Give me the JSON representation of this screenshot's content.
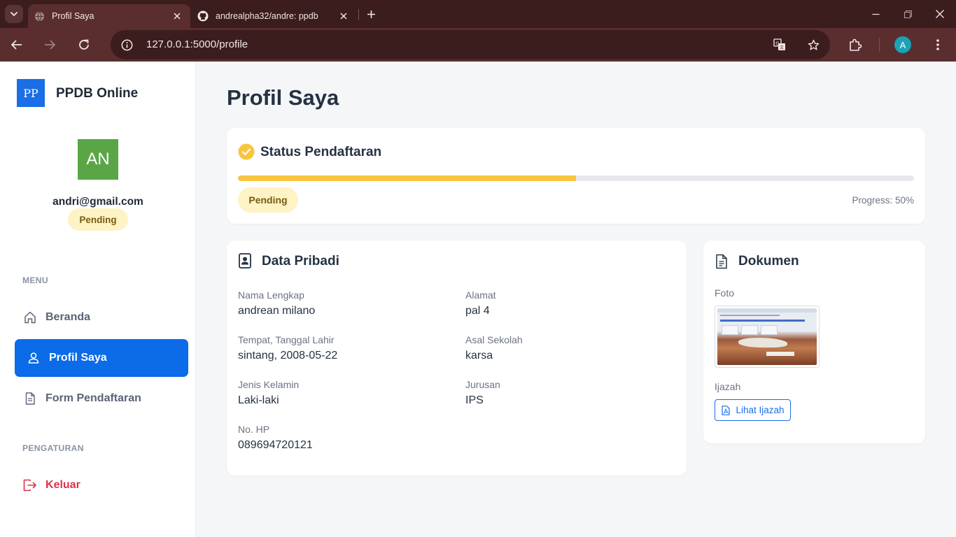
{
  "browser": {
    "tabs": [
      {
        "title": "Profil Saya",
        "active": true
      },
      {
        "title": "andrealpha32/andre: ppdb",
        "active": false
      }
    ],
    "url": "127.0.0.1:5000/profile",
    "profile_initial": "A",
    "theme_color": "#5a2e2e"
  },
  "sidebar": {
    "brand_logo": "PP",
    "brand_name": "PPDB Online",
    "avatar_initials": "AN",
    "email": "andri@gmail.com",
    "status_badge": "Pending",
    "menu_label": "MENU",
    "settings_label": "PENGATURAN",
    "menu_items": [
      {
        "label": "Beranda",
        "icon": "home-icon",
        "active": false
      },
      {
        "label": "Profil Saya",
        "icon": "user-icon",
        "active": true
      },
      {
        "label": "Form Pendaftaran",
        "icon": "document-icon",
        "active": false
      }
    ],
    "logout_label": "Keluar",
    "accent_color": "#0b6be8",
    "logout_color": "#e0304a"
  },
  "main": {
    "page_title": "Profil Saya",
    "status": {
      "title": "Status Pendaftaran",
      "progress_percent": 50,
      "badge": "Pending",
      "progress_text": "Progress: 50%",
      "progress_color": "#f9c43e"
    },
    "personal": {
      "title": "Data Pribadi",
      "fields": [
        {
          "label": "Nama Lengkap",
          "value": "andrean milano"
        },
        {
          "label": "Alamat",
          "value": "pal 4"
        },
        {
          "label": "Tempat, Tanggal Lahir",
          "value": "sintang, 2008-05-22"
        },
        {
          "label": "Asal Sekolah",
          "value": "karsa"
        },
        {
          "label": "Jenis Kelamin",
          "value": "Laki-laki"
        },
        {
          "label": "Jurusan",
          "value": "IPS"
        },
        {
          "label": "No. HP",
          "value": "089694720121"
        }
      ]
    },
    "documents": {
      "title": "Dokumen",
      "photo_label": "Foto",
      "ijazah_label": "Ijazah",
      "ijazah_button": "Lihat Ijazah"
    }
  }
}
